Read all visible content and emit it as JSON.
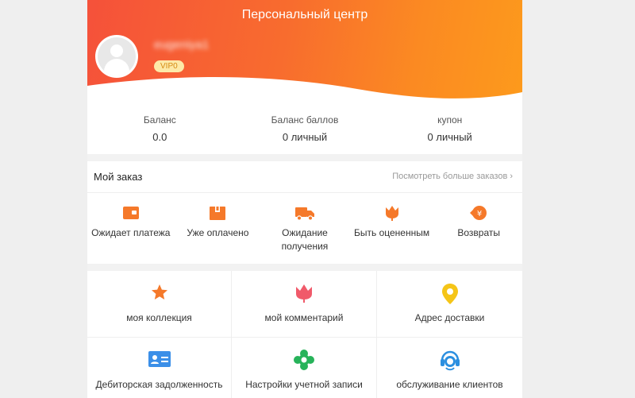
{
  "header": {
    "title": "Персональный центр",
    "username": "eugeniya1",
    "vip": "VIP0"
  },
  "stats": [
    {
      "label": "Баланс",
      "value": "0.0"
    },
    {
      "label": "Баланс баллов",
      "value": "0 личный"
    },
    {
      "label": "купон",
      "value": "0 личный"
    }
  ],
  "orders": {
    "title": "Мой заказ",
    "more": "Посмотреть больше заказов",
    "items": [
      {
        "label": "Ожидает платежа",
        "icon": "wallet-icon"
      },
      {
        "label": "Уже оплачено",
        "icon": "box-icon"
      },
      {
        "label": "Ожидание получения",
        "icon": "truck-icon"
      },
      {
        "label": "Быть оцененным",
        "icon": "tulip-icon"
      },
      {
        "label": "Возвраты",
        "icon": "refund-icon"
      }
    ]
  },
  "menu": [
    {
      "label": "моя коллекция",
      "icon": "star-icon",
      "color": "#f5792a"
    },
    {
      "label": "мой комментарий",
      "icon": "tulip-icon",
      "color": "#f05a6a"
    },
    {
      "label": "Адрес доставки",
      "icon": "location-pin-icon",
      "color": "#f5c518"
    },
    {
      "label": "Дебиторская задолженность",
      "icon": "id-card-icon",
      "color": "#3b8fe8"
    },
    {
      "label": "Настройки учетной записи",
      "icon": "settings-flower-icon",
      "color": "#27b35a"
    },
    {
      "label": "обслуживание клиентов",
      "icon": "customer-service-icon",
      "color": "#2b8fe0"
    }
  ],
  "colors": {
    "accent": "#f5792a",
    "header_start": "#f5513a",
    "header_end": "#fd9a1c"
  }
}
